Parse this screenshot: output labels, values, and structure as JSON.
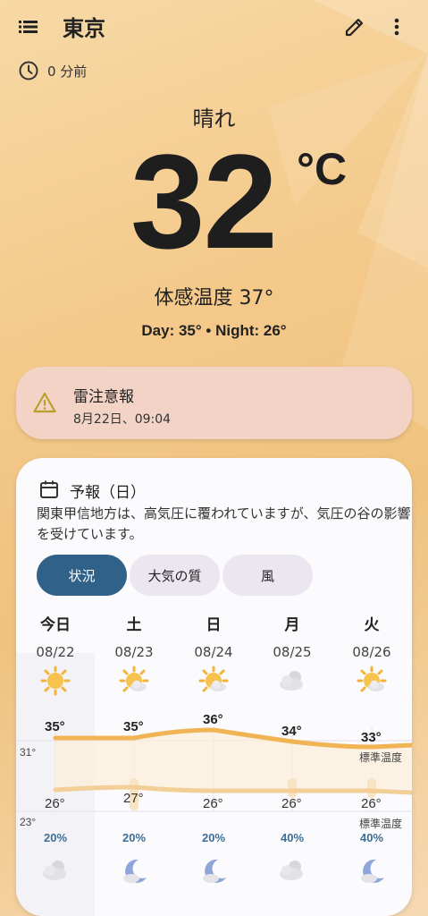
{
  "header": {
    "city": "東京"
  },
  "status": {
    "updated": "0 分前"
  },
  "current": {
    "condition": "晴れ",
    "temperature": "32",
    "unit": "°C",
    "feels_like": "体感温度 37°",
    "day_night": "Day: 35° • Night: 26°"
  },
  "alert": {
    "title": "雷注意報",
    "time": "8月22日、09:04"
  },
  "forecast": {
    "title": "予報（日）",
    "description": "関東甲信地方は、高気圧に覆われていますが、気圧の谷の影響を受けています。",
    "tabs": [
      "状況",
      "大気の質",
      "風"
    ],
    "active_tab": "状況",
    "axis": {
      "high_ref": "31°",
      "low_ref": "23°",
      "normal_label": "標準温度"
    },
    "days": [
      {
        "name": "今日",
        "date": "08/22",
        "high": "35°",
        "low": "26°",
        "precip": "20%",
        "day_icon": "sun-icon",
        "night_icon": "cloud-night-icon"
      },
      {
        "name": "土",
        "date": "08/23",
        "high": "35°",
        "low": "27°",
        "precip": "20%",
        "day_icon": "sun-cloud-icon",
        "night_icon": "moon-cloud-icon"
      },
      {
        "name": "日",
        "date": "08/24",
        "high": "36°",
        "low": "26°",
        "precip": "20%",
        "day_icon": "sun-cloud-icon",
        "night_icon": "moon-cloud-icon"
      },
      {
        "name": "月",
        "date": "08/25",
        "high": "34°",
        "low": "26°",
        "precip": "40%",
        "day_icon": "cloud-icon",
        "night_icon": "cloud-night-icon"
      },
      {
        "name": "火",
        "date": "08/26",
        "high": "33°",
        "low": "26°",
        "precip": "40%",
        "day_icon": "sun-cloud-icon",
        "night_icon": "moon-cloud-icon"
      }
    ]
  },
  "colors": {
    "high_line": "#f0b454",
    "low_line": "#f3cf97",
    "active_tab": "#2f6189",
    "alert_bg": "#f2d3c6",
    "precip_text": "#3d6f95"
  }
}
